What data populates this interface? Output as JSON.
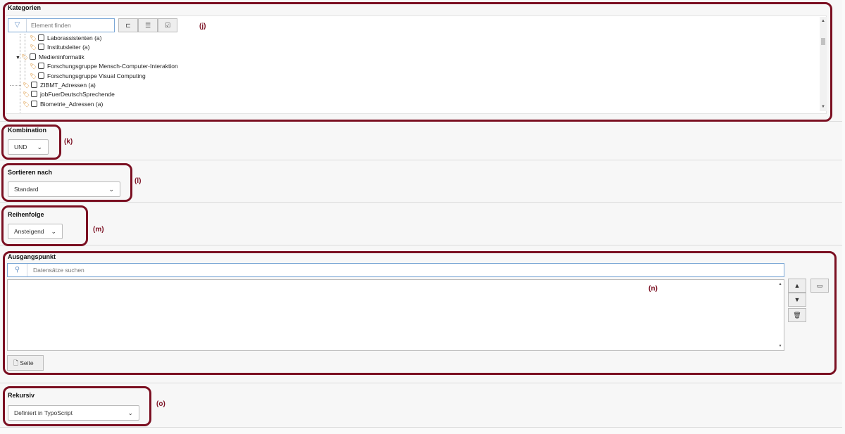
{
  "kategorien": {
    "label": "Kategorien",
    "filter_placeholder": "Element finden",
    "toolbar": {
      "tree_icon": "tree-collapse-icon",
      "list_icon": "list-expand-icon",
      "check_icon": "show-selected-icon"
    },
    "items": [
      {
        "label": "Laborassistenten (a)",
        "depth": 2,
        "toggle": ""
      },
      {
        "label": "Institutsleiter (a)",
        "depth": 2,
        "toggle": ""
      },
      {
        "label": "Medieninformatik",
        "depth": 1,
        "toggle": "▼"
      },
      {
        "label": "Forschungsgruppe Mensch-Computer-Interaktion",
        "depth": 2,
        "toggle": ""
      },
      {
        "label": "Forschungsgruppe Visual Computing",
        "depth": 2,
        "toggle": ""
      },
      {
        "label": "ZIBMT_Adressen (a)",
        "depth": 1,
        "toggle": ""
      },
      {
        "label": "jobFuerDeutschSprechende",
        "depth": 1,
        "toggle": ""
      },
      {
        "label": "Biometrie_Adressen (a)",
        "depth": 1,
        "toggle": ""
      }
    ],
    "annotation": "(j)"
  },
  "kombination": {
    "label": "Kombination",
    "value": "UND",
    "annotation": "(k)"
  },
  "sortieren": {
    "label": "Sortieren nach",
    "value": "Standard",
    "annotation": "(l)"
  },
  "reihenfolge": {
    "label": "Reihenfolge",
    "value": "Ansteigend",
    "annotation": "(m)"
  },
  "ausgangspunkt": {
    "label": "Ausgangspunkt",
    "search_placeholder": "Datensätze suchen",
    "page_button": "Seite",
    "annotation": "(n)"
  },
  "rekursiv": {
    "label": "Rekursiv",
    "value": "Definiert in TypoScript",
    "annotation": "(o)"
  },
  "colors": {
    "annotation": "#7b1022",
    "input_border": "#7ba7d6",
    "tag_icon": "#d98c2b"
  }
}
